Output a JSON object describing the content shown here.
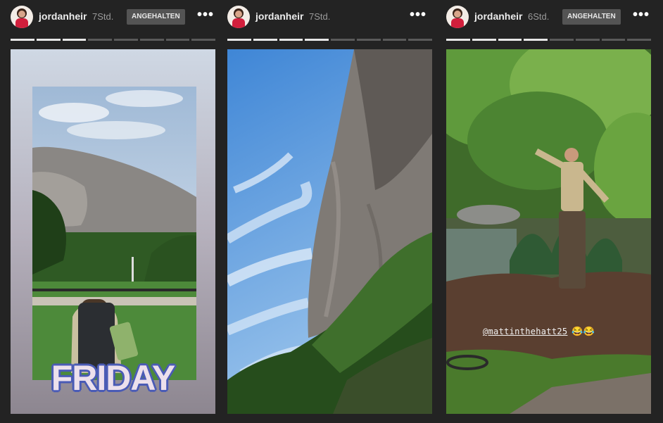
{
  "stories": [
    {
      "username": "jordanheir",
      "time": "7Std.",
      "badge": "ANGEHALTEN",
      "menu": "•••",
      "progress_segments": 8,
      "progress_done": 3,
      "overlay_text": "FRIDAY"
    },
    {
      "username": "jordanheir",
      "time": "7Std.",
      "menu": "•••",
      "progress_segments": 8,
      "progress_done": 4
    },
    {
      "username": "jordanheir",
      "time": "6Std.",
      "badge": "ANGEHALTEN",
      "menu": "•••",
      "progress_segments": 8,
      "progress_done": 4,
      "mention": "@mattinthehatt25",
      "mention_emoji": "😂😂"
    }
  ],
  "colors": {
    "background": "#232323",
    "badge": "#545454",
    "progress_done": "#e6e6e6",
    "progress_todo": "#5a5a5a",
    "friday_outline": "#4a5bb5"
  },
  "icons": [
    "avatar",
    "more-options-icon"
  ]
}
